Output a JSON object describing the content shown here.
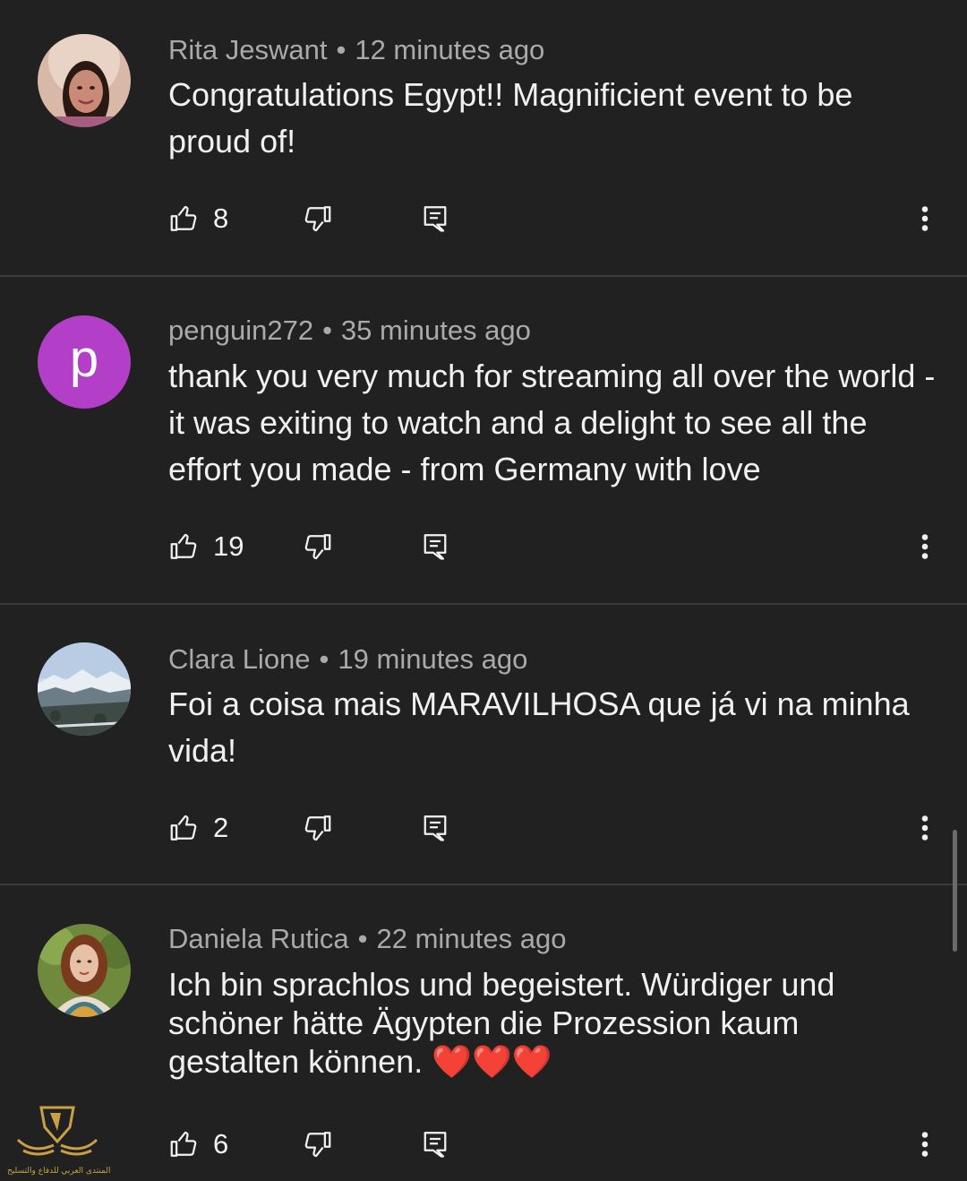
{
  "comments": [
    {
      "author": "Rita Jeswant",
      "time": "12 minutes ago",
      "text": "Congratulations Egypt!! Magnificient event to be proud of!",
      "likes": "8",
      "avatar": "photo"
    },
    {
      "author": "penguin272",
      "time": "35 minutes ago",
      "text": "thank you very much for streaming all over the world - it was exiting to watch and a delight to see all the effort you made - from Germany with love",
      "likes": "19",
      "avatar_letter": "p",
      "avatar_color": "#b33fc9"
    },
    {
      "author": "Clara Lione",
      "time": "19 minutes ago",
      "text": "Foi a coisa mais MARAVILHOSA que já vi na minha vida!",
      "likes": "2",
      "avatar": "landscape-photo"
    },
    {
      "author": "Daniela Rutica",
      "time": "22 minutes ago",
      "text": "Ich bin sprachlos und begeistert. Würdiger und schöner hätte Ägypten die Prozession kaum gestalten können. ❤️❤️❤️",
      "likes": "6",
      "avatar": "photo"
    }
  ],
  "separator": "•",
  "icons": {
    "like": "thumb-up-icon",
    "dislike": "thumb-down-icon",
    "reply": "reply-icon",
    "more": "more-vertical-icon"
  },
  "colors": {
    "background": "#212121",
    "text": "#f1f1f1",
    "meta": "#aaaaaa",
    "divider": "#3a3a3a"
  },
  "watermark": {
    "text": "المنتدى العربي للدفاع والتسليح"
  }
}
